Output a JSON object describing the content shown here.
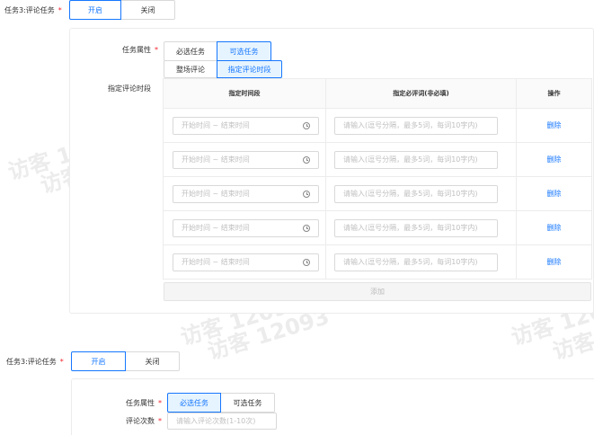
{
  "watermark": "访客 12093",
  "section1": {
    "label": "任务3:评论任务",
    "toggle": {
      "on": "开启",
      "off": "关闭",
      "selected": "on"
    },
    "attr_label": "任务属性",
    "attr_options": [
      "必选任务",
      "可选任务"
    ],
    "attr_selected": 1,
    "mode_options": [
      "整场评论",
      "指定评论时段"
    ],
    "mode_selected": 1,
    "period_label": "指定评论时段",
    "table": {
      "headers": [
        "指定时间段",
        "指定必评词(非必填)",
        "操作"
      ],
      "rows": [
        {
          "start": "开始时间",
          "sep": "~",
          "end": "结束时间",
          "words_placeholder": "请输入(逗号分隔，最多5词，每词10字内)",
          "action": "删除"
        },
        {
          "start": "开始时间",
          "sep": "~",
          "end": "结束时间",
          "words_placeholder": "请输入(逗号分隔，最多5词，每词10字内)",
          "action": "删除"
        },
        {
          "start": "开始时间",
          "sep": "~",
          "end": "结束时间",
          "words_placeholder": "请输入(逗号分隔，最多5词，每词10字内)",
          "action": "删除"
        },
        {
          "start": "开始时间",
          "sep": "~",
          "end": "结束时间",
          "words_placeholder": "请输入(逗号分隔，最多5词，每词10字内)",
          "action": "删除"
        },
        {
          "start": "开始时间",
          "sep": "~",
          "end": "结束时间",
          "words_placeholder": "请输入(逗号分隔，最多5词，每词10字内)",
          "action": "删除"
        }
      ]
    },
    "add_label": "添加"
  },
  "section2": {
    "label": "任务3:评论任务",
    "toggle": {
      "on": "开启",
      "off": "关闭",
      "selected": "on"
    },
    "attr_label": "任务属性",
    "attr_options": [
      "必选任务",
      "可选任务"
    ],
    "attr_selected": 0,
    "count_label": "评论次数",
    "count_placeholder": "请输入评论次数(1-10次)"
  },
  "colors": {
    "accent": "#1677ff",
    "required": "#f5222d",
    "active_bg": "#e6f4ff"
  }
}
